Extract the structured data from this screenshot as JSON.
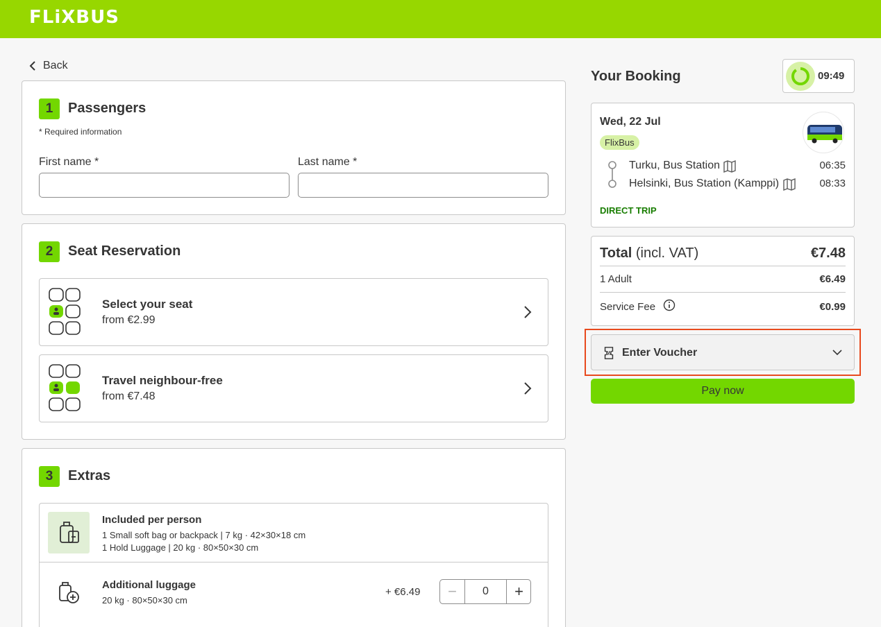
{
  "header": {
    "logo": "FLiXBUS"
  },
  "back_label": "Back",
  "passengers": {
    "step": "1",
    "title": "Passengers",
    "required_note": "* Required information",
    "first_name_label": "First name *",
    "last_name_label": "Last name *",
    "first_name_value": "",
    "last_name_value": ""
  },
  "seats": {
    "step": "2",
    "title": "Seat Reservation",
    "options": [
      {
        "title": "Select your seat",
        "price": "from €2.99"
      },
      {
        "title": "Travel neighbour-free",
        "price": "from €7.48"
      }
    ]
  },
  "extras": {
    "step": "3",
    "title": "Extras",
    "included": {
      "title": "Included per person",
      "line1": "1 Small soft bag or backpack | 7 kg · 42×30×18 cm",
      "line2": "1 Hold Luggage | 20 kg · 80×50×30 cm"
    },
    "additional": {
      "title": "Additional luggage",
      "detail": "20 kg · 80×50×30 cm",
      "price": "+ €6.49",
      "quantity": "0"
    }
  },
  "booking": {
    "title": "Your Booking",
    "timer": "09:49",
    "date": "Wed, 22 Jul",
    "operator": "FlixBus",
    "from_station": "Turku, Bus Station",
    "from_time": "06:35",
    "to_station": "Helsinki, Bus Station (Kamppi)",
    "to_time": "08:33",
    "trip_type": "DIRECT TRIP"
  },
  "total": {
    "label_bold": "Total",
    "label_note": "(incl. VAT)",
    "amount": "€7.48",
    "lines": [
      {
        "label": "1 Adult",
        "amount": "€6.49"
      },
      {
        "label": "Service Fee",
        "amount": "€0.99"
      }
    ]
  },
  "voucher_label": "Enter Voucher",
  "pay_label": "Pay now",
  "colors": {
    "brand_green": "#73d700",
    "header_green": "#97d700",
    "highlight": "#e8491d",
    "trip_green": "#187d00"
  }
}
